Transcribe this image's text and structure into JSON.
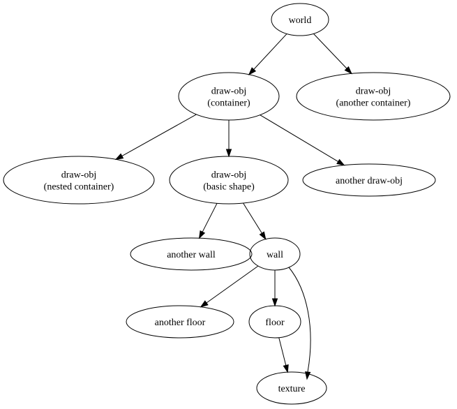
{
  "nodes": [
    {
      "id": "world",
      "lines": [
        "world"
      ]
    },
    {
      "id": "container",
      "lines": [
        "draw-obj",
        "(container)"
      ]
    },
    {
      "id": "another_container",
      "lines": [
        "draw-obj",
        "(another container)"
      ]
    },
    {
      "id": "nested_container",
      "lines": [
        "draw-obj",
        "(nested container)"
      ]
    },
    {
      "id": "basic_shape",
      "lines": [
        "draw-obj",
        "(basic shape)"
      ]
    },
    {
      "id": "another_draw_obj",
      "lines": [
        "another draw-obj"
      ]
    },
    {
      "id": "another_wall",
      "lines": [
        "another wall"
      ]
    },
    {
      "id": "wall",
      "lines": [
        "wall"
      ]
    },
    {
      "id": "another_floor",
      "lines": [
        "another floor"
      ]
    },
    {
      "id": "floor",
      "lines": [
        "floor"
      ]
    },
    {
      "id": "texture",
      "lines": [
        "texture"
      ]
    }
  ],
  "edges": [
    {
      "from": "world",
      "to": "container"
    },
    {
      "from": "world",
      "to": "another_container"
    },
    {
      "from": "container",
      "to": "nested_container"
    },
    {
      "from": "container",
      "to": "basic_shape"
    },
    {
      "from": "container",
      "to": "another_draw_obj"
    },
    {
      "from": "basic_shape",
      "to": "another_wall"
    },
    {
      "from": "basic_shape",
      "to": "wall"
    },
    {
      "from": "wall",
      "to": "another_floor"
    },
    {
      "from": "wall",
      "to": "floor"
    },
    {
      "from": "wall",
      "to": "texture"
    },
    {
      "from": "floor",
      "to": "texture"
    }
  ]
}
